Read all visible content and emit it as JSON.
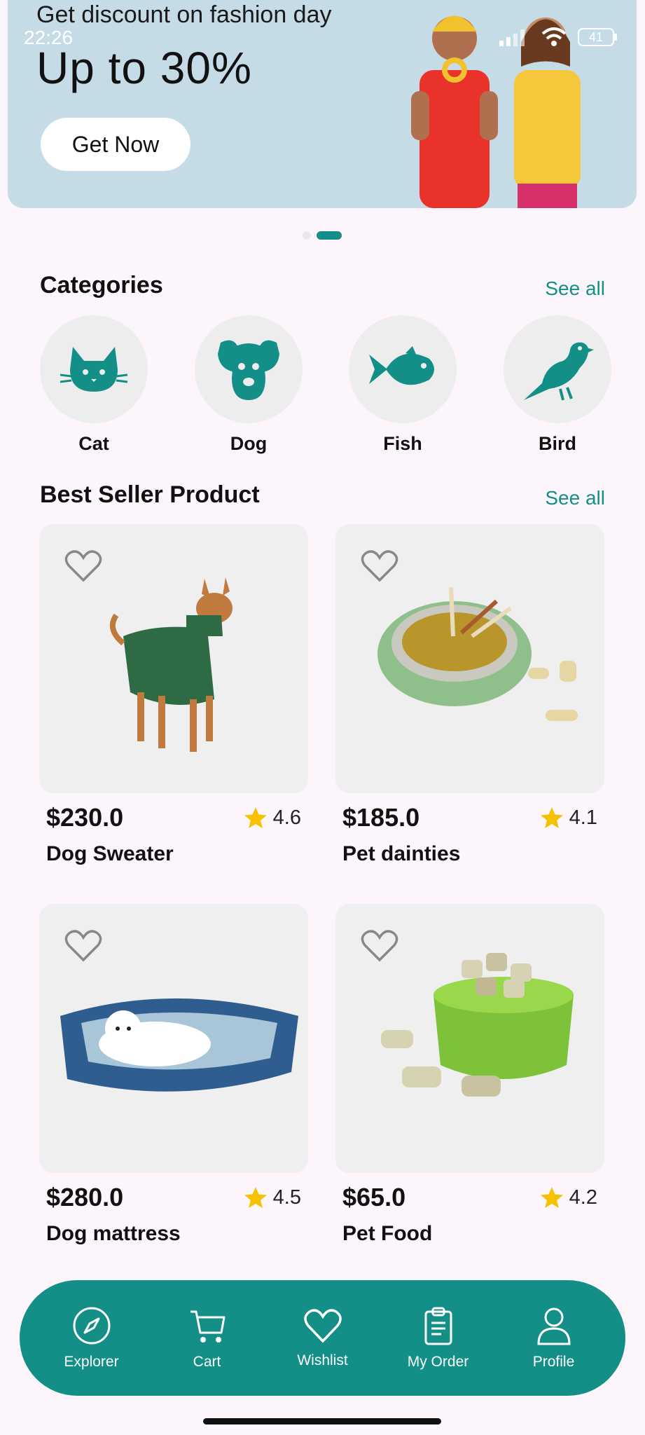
{
  "status": {
    "time": "22:26",
    "battery": "41"
  },
  "banner": {
    "subtitle": "Get discount on fashion day",
    "title": "Up to 30%",
    "button_label": "Get Now"
  },
  "carousel": {
    "count": 2,
    "active_index": 1
  },
  "categories": {
    "title": "Categories",
    "see_all": "See all",
    "items": [
      {
        "label": "Cat",
        "icon": "cat-icon"
      },
      {
        "label": "Dog",
        "icon": "dog-icon"
      },
      {
        "label": "Fish",
        "icon": "fish-icon"
      },
      {
        "label": "Bird",
        "icon": "bird-icon"
      }
    ]
  },
  "best_seller": {
    "title": "Best Seller Product",
    "see_all": "See all",
    "products": [
      {
        "price": "$230.0",
        "rating": "4.6",
        "name": "Dog Sweater"
      },
      {
        "price": "$185.0",
        "rating": "4.1",
        "name": "Pet dainties"
      },
      {
        "price": "$280.0",
        "rating": "4.5",
        "name": "Dog mattress"
      },
      {
        "price": "$65.0",
        "rating": "4.2",
        "name": "Pet Food"
      }
    ]
  },
  "nav": {
    "items": [
      {
        "label": "Explorer",
        "icon": "compass-icon"
      },
      {
        "label": "Cart",
        "icon": "cart-icon"
      },
      {
        "label": "Wishlist",
        "icon": "heart-icon"
      },
      {
        "label": "My Order",
        "icon": "clipboard-icon"
      },
      {
        "label": "Profile",
        "icon": "user-icon"
      }
    ]
  },
  "colors": {
    "accent": "#138f87",
    "banner_bg": "#c5dbe6",
    "star": "#f6c200",
    "page_bg": "#fcf6fc"
  }
}
